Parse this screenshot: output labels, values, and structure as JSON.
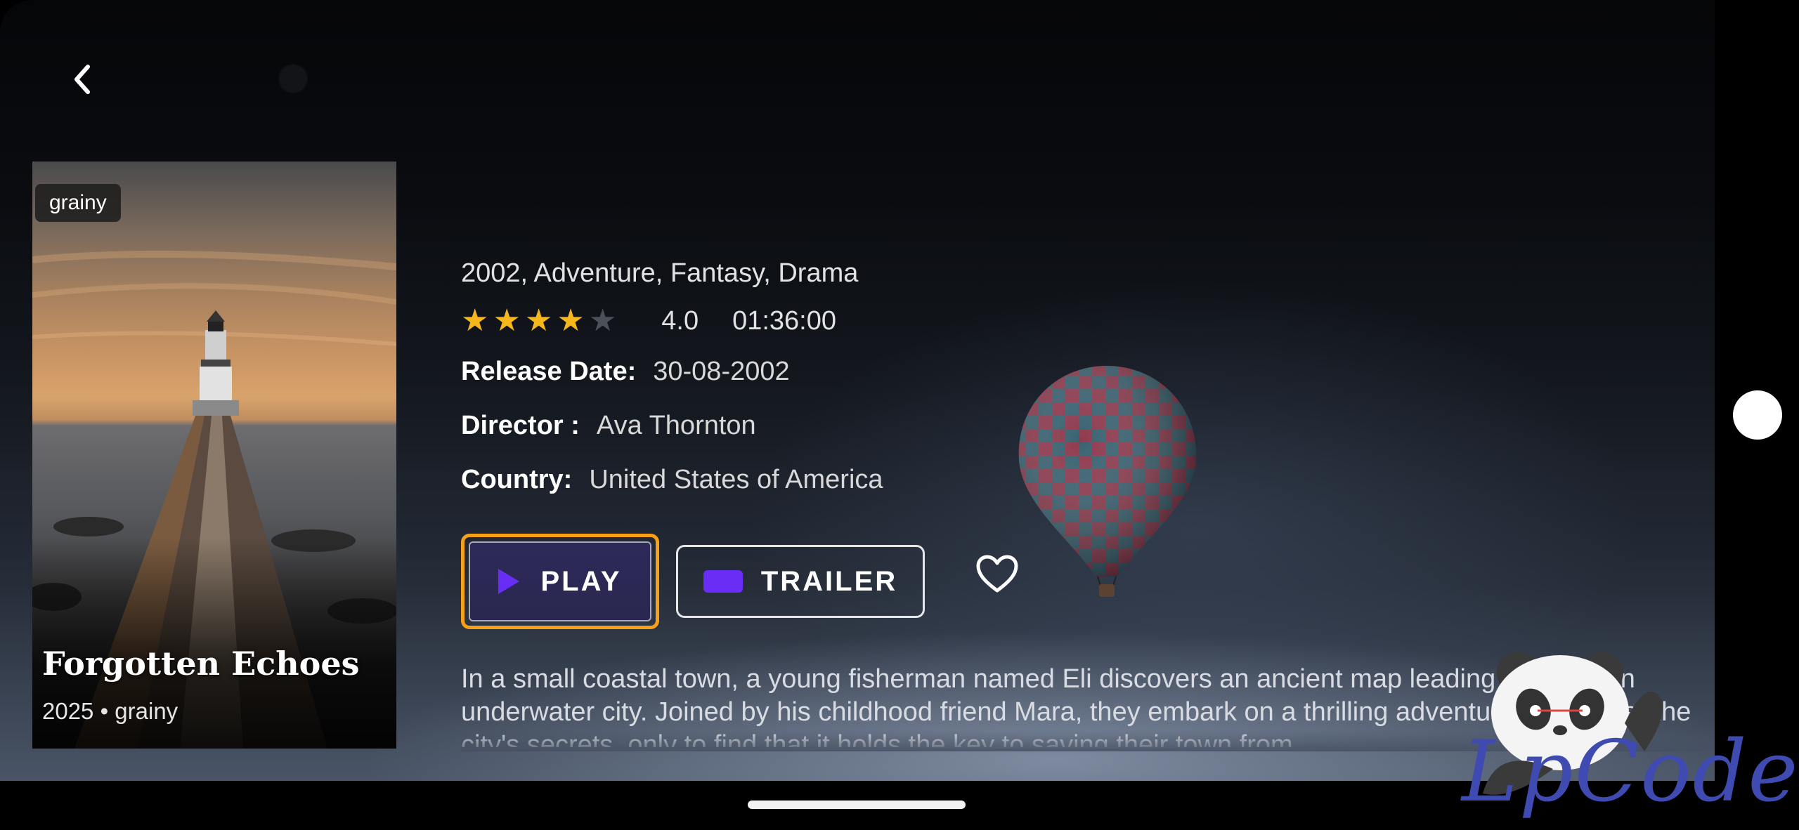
{
  "poster": {
    "badge": "grainy",
    "title": "Forgotten Echoes",
    "meta": "2025 • grainy"
  },
  "movie": {
    "genres": "2002, Adventure, Fantasy, Drama",
    "rating_value": "4.0",
    "stars_filled": 4,
    "stars_total": 5,
    "duration": "01:36:00",
    "release_label": "Release Date:",
    "release_value": "30-08-2002",
    "director_label": "Director :",
    "director_value": "Ava Thornton",
    "country_label": "Country:",
    "country_value": "United States of America",
    "description": "In a small coastal town, a young fisherman named Eli discovers an ancient map leading to a hidden underwater city. Joined by his childhood friend Mara, they embark on a thrilling adventure to uncover the city's secrets, only to find that it holds the key to saving their town from..."
  },
  "actions": {
    "play_label": "PLAY",
    "trailer_label": "TRAILER"
  },
  "icons": {
    "back": "chevron-left-icon",
    "play": "play-icon",
    "trailer": "video-icon",
    "favorite": "heart-outline-icon"
  },
  "colors": {
    "accent_orange": "#f7a11a",
    "accent_purple": "#6a2df5",
    "star": "#f5b71b"
  },
  "watermark": {
    "text": "LpCodes"
  }
}
